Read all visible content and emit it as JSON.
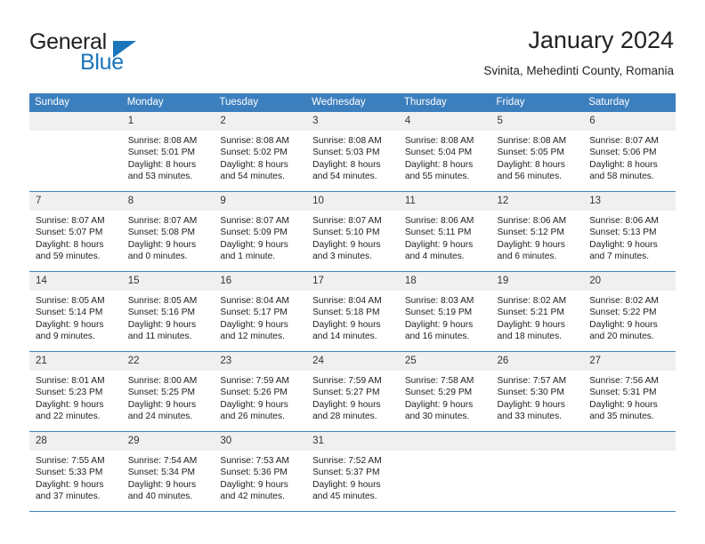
{
  "brand": {
    "name_part1": "General",
    "name_part2": "Blue",
    "triangle_color": "#1b75bb"
  },
  "header": {
    "title": "January 2024",
    "subtitle": "Svinita, Mehedinti County, Romania"
  },
  "theme": {
    "header_blue": "#3c7fbe",
    "daynum_band": "#f0f0f0",
    "text": "#222222"
  },
  "weekdays": [
    "Sunday",
    "Monday",
    "Tuesday",
    "Wednesday",
    "Thursday",
    "Friday",
    "Saturday"
  ],
  "weeks": [
    [
      {
        "day": "",
        "empty": true,
        "sunrise": "",
        "sunset": "",
        "daylight_line1": "",
        "daylight_line2": ""
      },
      {
        "day": "1",
        "sunrise": "Sunrise: 8:08 AM",
        "sunset": "Sunset: 5:01 PM",
        "daylight_line1": "Daylight: 8 hours",
        "daylight_line2": "and 53 minutes."
      },
      {
        "day": "2",
        "sunrise": "Sunrise: 8:08 AM",
        "sunset": "Sunset: 5:02 PM",
        "daylight_line1": "Daylight: 8 hours",
        "daylight_line2": "and 54 minutes."
      },
      {
        "day": "3",
        "sunrise": "Sunrise: 8:08 AM",
        "sunset": "Sunset: 5:03 PM",
        "daylight_line1": "Daylight: 8 hours",
        "daylight_line2": "and 54 minutes."
      },
      {
        "day": "4",
        "sunrise": "Sunrise: 8:08 AM",
        "sunset": "Sunset: 5:04 PM",
        "daylight_line1": "Daylight: 8 hours",
        "daylight_line2": "and 55 minutes."
      },
      {
        "day": "5",
        "sunrise": "Sunrise: 8:08 AM",
        "sunset": "Sunset: 5:05 PM",
        "daylight_line1": "Daylight: 8 hours",
        "daylight_line2": "and 56 minutes."
      },
      {
        "day": "6",
        "sunrise": "Sunrise: 8:07 AM",
        "sunset": "Sunset: 5:06 PM",
        "daylight_line1": "Daylight: 8 hours",
        "daylight_line2": "and 58 minutes."
      }
    ],
    [
      {
        "day": "7",
        "sunrise": "Sunrise: 8:07 AM",
        "sunset": "Sunset: 5:07 PM",
        "daylight_line1": "Daylight: 8 hours",
        "daylight_line2": "and 59 minutes."
      },
      {
        "day": "8",
        "sunrise": "Sunrise: 8:07 AM",
        "sunset": "Sunset: 5:08 PM",
        "daylight_line1": "Daylight: 9 hours",
        "daylight_line2": "and 0 minutes."
      },
      {
        "day": "9",
        "sunrise": "Sunrise: 8:07 AM",
        "sunset": "Sunset: 5:09 PM",
        "daylight_line1": "Daylight: 9 hours",
        "daylight_line2": "and 1 minute."
      },
      {
        "day": "10",
        "sunrise": "Sunrise: 8:07 AM",
        "sunset": "Sunset: 5:10 PM",
        "daylight_line1": "Daylight: 9 hours",
        "daylight_line2": "and 3 minutes."
      },
      {
        "day": "11",
        "sunrise": "Sunrise: 8:06 AM",
        "sunset": "Sunset: 5:11 PM",
        "daylight_line1": "Daylight: 9 hours",
        "daylight_line2": "and 4 minutes."
      },
      {
        "day": "12",
        "sunrise": "Sunrise: 8:06 AM",
        "sunset": "Sunset: 5:12 PM",
        "daylight_line1": "Daylight: 9 hours",
        "daylight_line2": "and 6 minutes."
      },
      {
        "day": "13",
        "sunrise": "Sunrise: 8:06 AM",
        "sunset": "Sunset: 5:13 PM",
        "daylight_line1": "Daylight: 9 hours",
        "daylight_line2": "and 7 minutes."
      }
    ],
    [
      {
        "day": "14",
        "sunrise": "Sunrise: 8:05 AM",
        "sunset": "Sunset: 5:14 PM",
        "daylight_line1": "Daylight: 9 hours",
        "daylight_line2": "and 9 minutes."
      },
      {
        "day": "15",
        "sunrise": "Sunrise: 8:05 AM",
        "sunset": "Sunset: 5:16 PM",
        "daylight_line1": "Daylight: 9 hours",
        "daylight_line2": "and 11 minutes."
      },
      {
        "day": "16",
        "sunrise": "Sunrise: 8:04 AM",
        "sunset": "Sunset: 5:17 PM",
        "daylight_line1": "Daylight: 9 hours",
        "daylight_line2": "and 12 minutes."
      },
      {
        "day": "17",
        "sunrise": "Sunrise: 8:04 AM",
        "sunset": "Sunset: 5:18 PM",
        "daylight_line1": "Daylight: 9 hours",
        "daylight_line2": "and 14 minutes."
      },
      {
        "day": "18",
        "sunrise": "Sunrise: 8:03 AM",
        "sunset": "Sunset: 5:19 PM",
        "daylight_line1": "Daylight: 9 hours",
        "daylight_line2": "and 16 minutes."
      },
      {
        "day": "19",
        "sunrise": "Sunrise: 8:02 AM",
        "sunset": "Sunset: 5:21 PM",
        "daylight_line1": "Daylight: 9 hours",
        "daylight_line2": "and 18 minutes."
      },
      {
        "day": "20",
        "sunrise": "Sunrise: 8:02 AM",
        "sunset": "Sunset: 5:22 PM",
        "daylight_line1": "Daylight: 9 hours",
        "daylight_line2": "and 20 minutes."
      }
    ],
    [
      {
        "day": "21",
        "sunrise": "Sunrise: 8:01 AM",
        "sunset": "Sunset: 5:23 PM",
        "daylight_line1": "Daylight: 9 hours",
        "daylight_line2": "and 22 minutes."
      },
      {
        "day": "22",
        "sunrise": "Sunrise: 8:00 AM",
        "sunset": "Sunset: 5:25 PM",
        "daylight_line1": "Daylight: 9 hours",
        "daylight_line2": "and 24 minutes."
      },
      {
        "day": "23",
        "sunrise": "Sunrise: 7:59 AM",
        "sunset": "Sunset: 5:26 PM",
        "daylight_line1": "Daylight: 9 hours",
        "daylight_line2": "and 26 minutes."
      },
      {
        "day": "24",
        "sunrise": "Sunrise: 7:59 AM",
        "sunset": "Sunset: 5:27 PM",
        "daylight_line1": "Daylight: 9 hours",
        "daylight_line2": "and 28 minutes."
      },
      {
        "day": "25",
        "sunrise": "Sunrise: 7:58 AM",
        "sunset": "Sunset: 5:29 PM",
        "daylight_line1": "Daylight: 9 hours",
        "daylight_line2": "and 30 minutes."
      },
      {
        "day": "26",
        "sunrise": "Sunrise: 7:57 AM",
        "sunset": "Sunset: 5:30 PM",
        "daylight_line1": "Daylight: 9 hours",
        "daylight_line2": "and 33 minutes."
      },
      {
        "day": "27",
        "sunrise": "Sunrise: 7:56 AM",
        "sunset": "Sunset: 5:31 PM",
        "daylight_line1": "Daylight: 9 hours",
        "daylight_line2": "and 35 minutes."
      }
    ],
    [
      {
        "day": "28",
        "sunrise": "Sunrise: 7:55 AM",
        "sunset": "Sunset: 5:33 PM",
        "daylight_line1": "Daylight: 9 hours",
        "daylight_line2": "and 37 minutes."
      },
      {
        "day": "29",
        "sunrise": "Sunrise: 7:54 AM",
        "sunset": "Sunset: 5:34 PM",
        "daylight_line1": "Daylight: 9 hours",
        "daylight_line2": "and 40 minutes."
      },
      {
        "day": "30",
        "sunrise": "Sunrise: 7:53 AM",
        "sunset": "Sunset: 5:36 PM",
        "daylight_line1": "Daylight: 9 hours",
        "daylight_line2": "and 42 minutes."
      },
      {
        "day": "31",
        "sunrise": "Sunrise: 7:52 AM",
        "sunset": "Sunset: 5:37 PM",
        "daylight_line1": "Daylight: 9 hours",
        "daylight_line2": "and 45 minutes."
      },
      {
        "day": "",
        "empty": true,
        "sunrise": "",
        "sunset": "",
        "daylight_line1": "",
        "daylight_line2": ""
      },
      {
        "day": "",
        "empty": true,
        "sunrise": "",
        "sunset": "",
        "daylight_line1": "",
        "daylight_line2": ""
      },
      {
        "day": "",
        "empty": true,
        "sunrise": "",
        "sunset": "",
        "daylight_line1": "",
        "daylight_line2": ""
      }
    ]
  ]
}
